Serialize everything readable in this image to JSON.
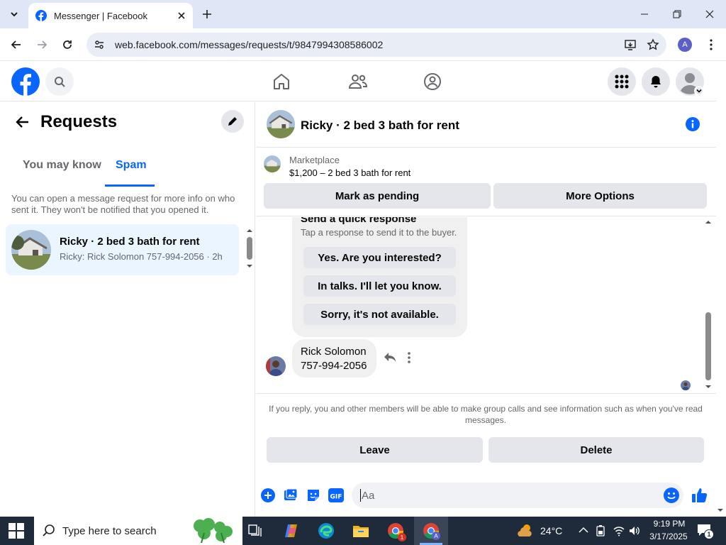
{
  "browser": {
    "tab_title": "Messenger | Facebook",
    "url": "web.facebook.com/messages/requests/t/9847994308586002",
    "profile_letter": "A"
  },
  "sidebar": {
    "title": "Requests",
    "tabs": [
      {
        "label": "You may know"
      },
      {
        "label": "Spam"
      }
    ],
    "active_tab": "Spam",
    "info": "You can open a message request for more info on who sent it. They won't be notified that you opened it.",
    "requests": [
      {
        "name": "Ricky · 2 bed 3 bath for rent",
        "preview": "Ricky: Rick Solomon 757-994-2056 · 2h"
      }
    ]
  },
  "chat": {
    "title": "Ricky · 2 bed 3 bath for rent",
    "marketplace_label": "Marketplace",
    "listing": "$1,200 – 2 bed 3 bath for rent",
    "mark_pending": "Mark as pending",
    "more_options": "More Options",
    "quick_response_title": "Send a quick response",
    "quick_response_sub": "Tap a response to send it to the buyer.",
    "quick_responses": [
      "Yes. Are you interested?",
      "In talks. I'll let you know.",
      "Sorry, it's not available."
    ],
    "message_line1": "Rick Solomon",
    "message_line2": "757-994-2056",
    "notice": "If you reply, you and other members will be able to make group calls and see information such as when you've read messages.",
    "leave": "Leave",
    "delete": "Delete",
    "composer_placeholder": "Aa"
  },
  "taskbar": {
    "search_placeholder": "Type here to search",
    "weather": "24°C",
    "time": "9:19 PM",
    "date": "3/17/2025",
    "notification_count": "1",
    "chrome_badge": "1"
  },
  "colors": {
    "fb_blue": "#0866ff",
    "tab_underline": "#0866ff"
  }
}
